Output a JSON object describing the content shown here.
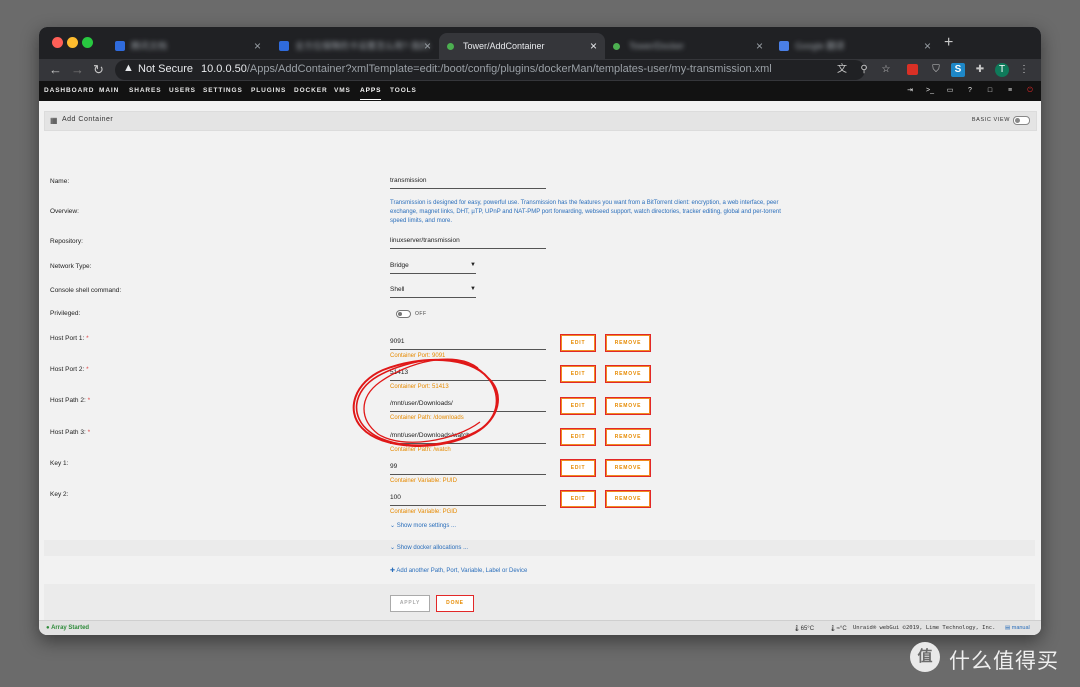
{
  "browser": {
    "tabs": [
      {
        "title": "腾讯文档",
        "active": false,
        "fav_color": "#2f6bdc"
      },
      {
        "title": "全方位保障的卡设置怎么用?·我的·",
        "active": false,
        "fav_color": "#2f6bdc"
      },
      {
        "title": "Tower/AddContainer",
        "active": true,
        "fav_color": "#4caf50"
      },
      {
        "title": "Tower/Docker",
        "active": false,
        "fav_color": "#4caf50"
      },
      {
        "title": "Google 翻译",
        "active": false,
        "fav_color": "#4a7fe6"
      }
    ],
    "close_glyph": "×",
    "new_tab": "+",
    "security_label": "Not Secure",
    "url_host": "10.0.0.50",
    "url_path": "/Apps/AddContainer?xmlTemplate=edit:/boot/config/plugins/dockerMan/templates-user/my-transmission.xml",
    "profile_initial": "T"
  },
  "nav": {
    "items": [
      "DASHBOARD",
      "MAIN",
      "SHARES",
      "USERS",
      "SETTINGS",
      "PLUGINS",
      "DOCKER",
      "VMS",
      "APPS",
      "TOOLS"
    ],
    "active": "APPS"
  },
  "panel": {
    "title": "Add Container",
    "basic_view": "BASIC VIEW"
  },
  "form": {
    "name_label": "Name:",
    "name_value": "transmission",
    "overview_label": "Overview:",
    "overview_value": "Transmission is designed for easy, powerful use. Transmission has the features you want from a BitTorrent client: encryption, a web interface, peer exchange, magnet links, DHT, µTP, UPnP and NAT-PMP port forwarding, webseed support, watch directories, tracker editing, global and per-torrent speed limits, and more.",
    "repository_label": "Repository:",
    "repository_value": "linuxserver/transmission",
    "network_label": "Network Type:",
    "network_value": "Bridge",
    "console_label": "Console shell command:",
    "console_value": "Shell",
    "privileged_label": "Privileged:",
    "privileged_state": "OFF",
    "rows": [
      {
        "label": "Host Port 1:",
        "value": "9091",
        "sub": "Container Port: 9091"
      },
      {
        "label": "Host Port 2:",
        "value": "51413",
        "sub": "Container Port: 51413"
      },
      {
        "label": "Host Path 2:",
        "value": "/mnt/user/Downloads/",
        "sub": "Container Path: /downloads"
      },
      {
        "label": "Host Path 3:",
        "value": "/mnt/user/Downloads/watch",
        "sub": "Container Path: /watch"
      },
      {
        "label": "Key 1:",
        "value": "99",
        "sub": "Container Variable: PUID"
      },
      {
        "label": "Key 2:",
        "value": "100",
        "sub": "Container Variable: PGID"
      }
    ],
    "required_mark": "*",
    "edit_label": "EDIT",
    "remove_label": "REMOVE",
    "show_more": "Show more settings ...",
    "show_docker": "Show docker allocations ...",
    "add_another": "Add another Path, Port, Variable, Label or Device",
    "apply_label": "APPLY",
    "done_label": "DONE"
  },
  "footer": {
    "status": "Array Started",
    "temp1": "65°C",
    "temp2": "≈°C",
    "copyright": "Unraid® webGui ©2019, Lime Technology, Inc.",
    "manual": "manual"
  },
  "watermark": {
    "logo": "值",
    "text": "什么值得买"
  },
  "colors": {
    "accent_orange": "#e68a00",
    "button_border_red": "#e22828",
    "link_blue": "#2a6ebb",
    "annotation_red": "#e01818",
    "status_green": "#2e8b3a"
  }
}
